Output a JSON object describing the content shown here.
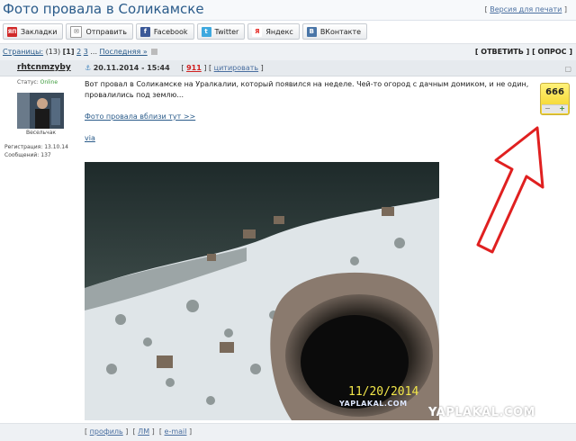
{
  "page": {
    "title": "Фото провала в Соликамске",
    "print_link": "Версия для печати"
  },
  "share": [
    {
      "label": "Закладки",
      "icon": "yap-icon",
      "color": "#d12a2a",
      "glyph": "ЯП"
    },
    {
      "label": "Отправить",
      "icon": "mail-icon",
      "color": "#8a8a8a",
      "glyph": "✉"
    },
    {
      "label": "Facebook",
      "icon": "facebook-icon",
      "color": "#3b5998",
      "glyph": "f"
    },
    {
      "label": "Twitter",
      "icon": "twitter-icon",
      "color": "#3fa9df",
      "glyph": "t"
    },
    {
      "label": "Яндекс",
      "icon": "yandex-icon",
      "color": "#e52620",
      "glyph": "Я"
    },
    {
      "label": "ВКонтакте",
      "icon": "vk-icon",
      "color": "#4a76a8",
      "glyph": "В"
    }
  ],
  "nav": {
    "pages_label": "Страницы:",
    "pages_count": "(13)",
    "current_page": "[1]",
    "page2": "2",
    "page3": "3",
    "ellipsis": "...",
    "last": "Последняя »",
    "reply": "[ ОТВЕТИТЬ ]",
    "poll": "[ ОПРОС ]"
  },
  "post": {
    "author": "rhtcnmzyby",
    "datetime": "20.11.2014 - 15:44",
    "number": "911",
    "cite": "цитировать",
    "status_label": "Статус:",
    "status_value": "Online",
    "rank": "Весельчак",
    "reg_label": "Регистрация:",
    "reg_date": "13.10.14",
    "msgs_label": "Сообщений:",
    "msgs_count": "137",
    "text": "Вот провал в Соликамске на Уралкалии, который появился на неделе. Чей-то огород с дачным домиком, и не один, провалились под землю...",
    "link": "Фото провала вблизи тут >>",
    "via": "via",
    "rating": "666",
    "photo_date": "11/20/2014",
    "photo_wm": "YAPLAKAL.COM"
  },
  "footer": {
    "profile": "профиль",
    "pm": "ЛМ",
    "email": "e-mail"
  },
  "watermark": "YAPLAKAL.COM"
}
